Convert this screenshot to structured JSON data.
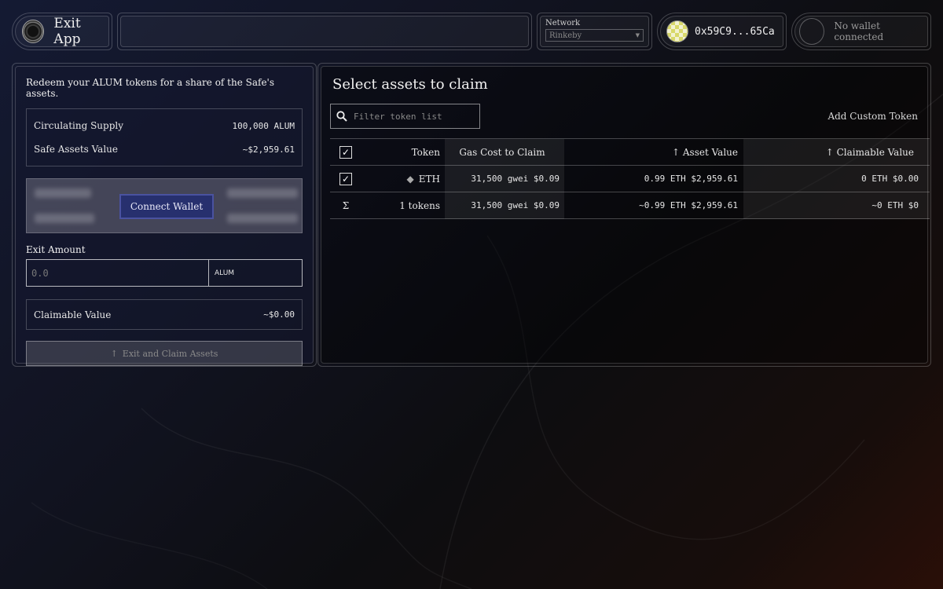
{
  "header": {
    "exit_app_label": "Exit App",
    "network_label": "Network",
    "network_value": "Rinkeby",
    "account_address": "0x59C9...65Ca",
    "no_wallet_label": "No wallet connected"
  },
  "left": {
    "intro": "Redeem your ALUM tokens for a share of the Safe's assets.",
    "circulating_supply_label": "Circulating Supply",
    "circulating_supply_value": "100,000 ALUM",
    "safe_assets_label": "Safe Assets Value",
    "safe_assets_value": "~$2,959.61",
    "connect_wallet_label": "Connect Wallet",
    "exit_amount_label": "Exit Amount",
    "exit_amount_placeholder": "0.0",
    "exit_unit": "ALUM",
    "claimable_label": "Claimable Value",
    "claimable_value": "~$0.00",
    "exit_button_label": "Exit and Claim Assets"
  },
  "right": {
    "title": "Select assets to claim",
    "filter_placeholder": "Filter token list",
    "add_custom_token": "Add Custom Token",
    "columns": {
      "token": "Token",
      "gas": "Gas Cost to Claim",
      "asset": "Asset Value",
      "claimable": "Claimable Value"
    },
    "rows": [
      {
        "token": "ETH",
        "gas": "31,500 gwei $0.09",
        "asset": "0.99 ETH $2,959.61",
        "claimable": "0 ETH $0.00"
      }
    ],
    "summary": {
      "symbol": "Σ",
      "token": "1 tokens",
      "gas": "31,500 gwei $0.09",
      "asset": "~0.99 ETH $2,959.61",
      "claimable": "~0 ETH $0"
    }
  }
}
